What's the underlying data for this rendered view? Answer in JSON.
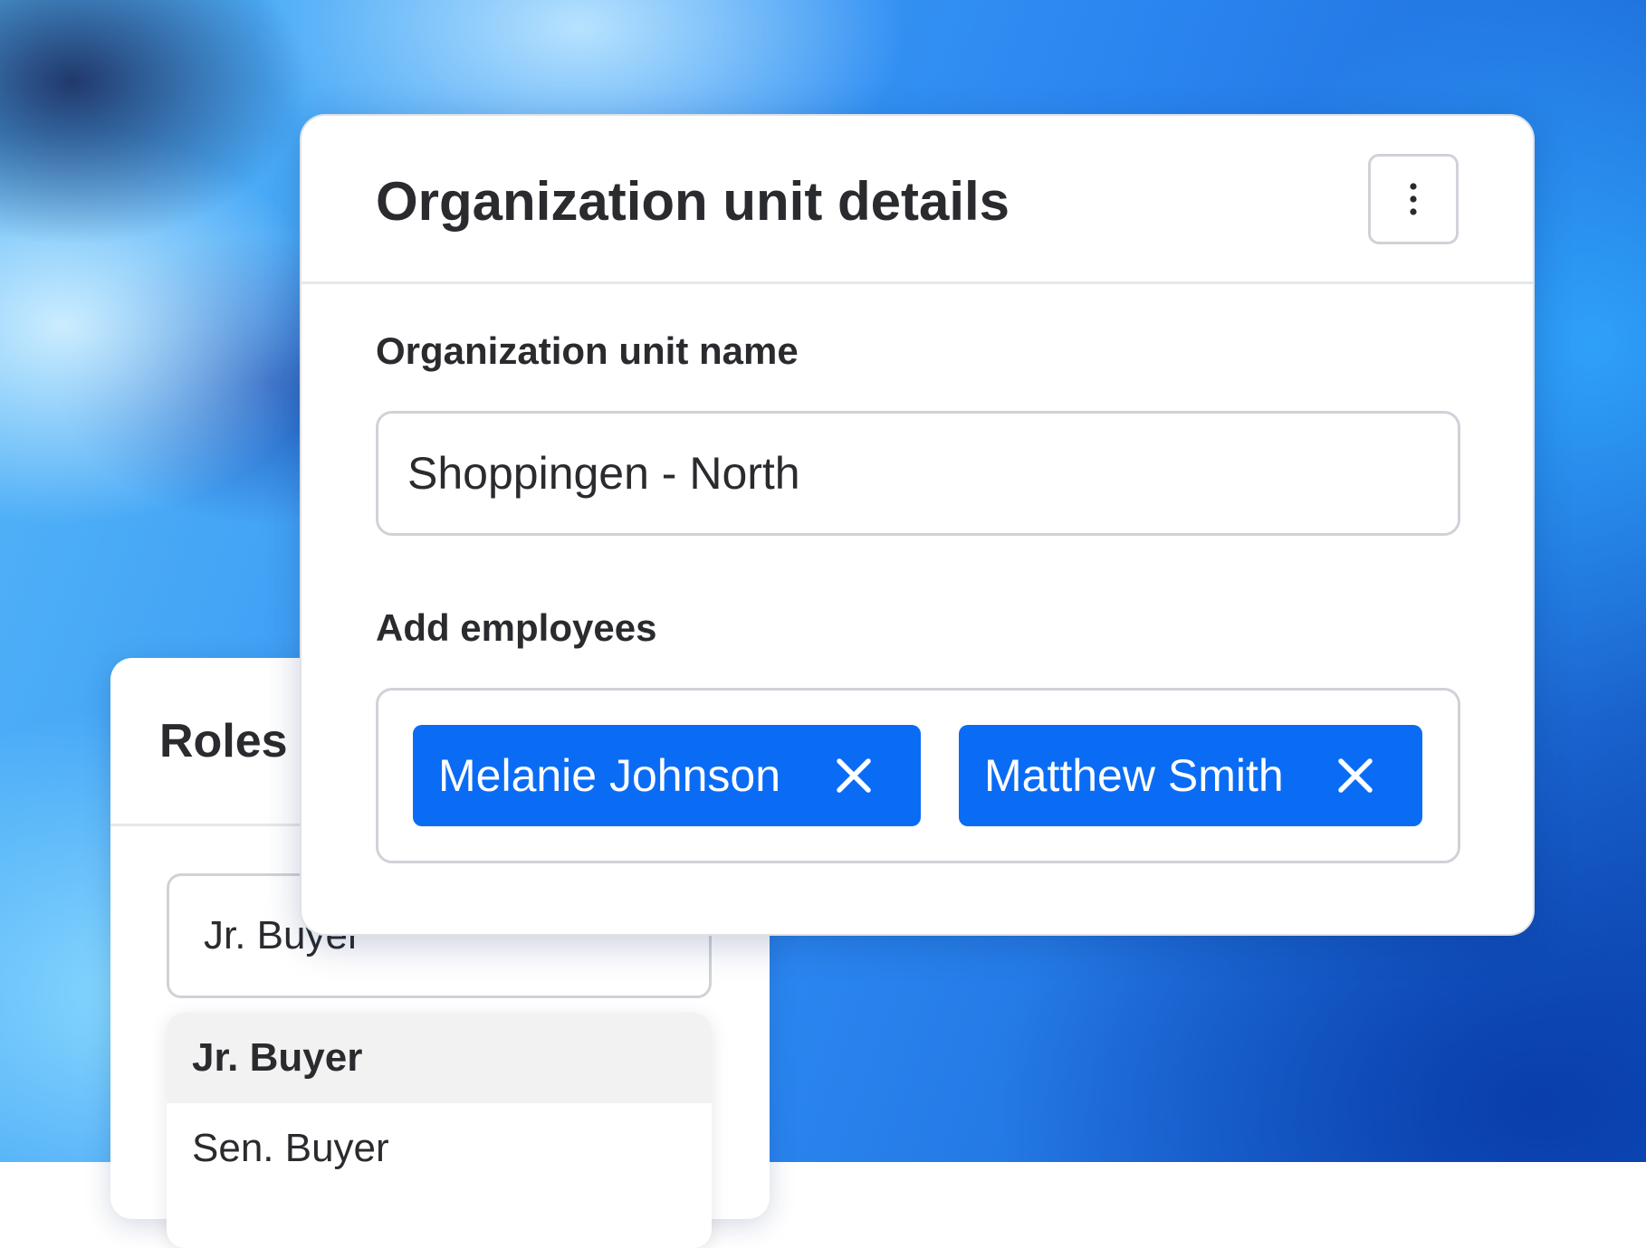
{
  "roles_card": {
    "title": "Roles",
    "search_value": "Jr. Buyer",
    "options": [
      {
        "label": "Jr. Buyer",
        "selected": true
      },
      {
        "label": "Sen. Buyer",
        "selected": false
      }
    ]
  },
  "org_card": {
    "title": "Organization unit details",
    "more_icon": "vertical-ellipsis-icon",
    "name_field": {
      "label": "Organization unit name",
      "value": "Shoppingen - North"
    },
    "employees_field": {
      "label": "Add employees",
      "chips": [
        {
          "name": "Melanie Johnson",
          "remove_icon": "close-icon"
        },
        {
          "name": "Matthew Smith",
          "remove_icon": "close-icon"
        }
      ]
    }
  },
  "colors": {
    "chip_background": "#0a6cf5",
    "text": "#2a2b2e",
    "border": "#d0d2d8"
  }
}
